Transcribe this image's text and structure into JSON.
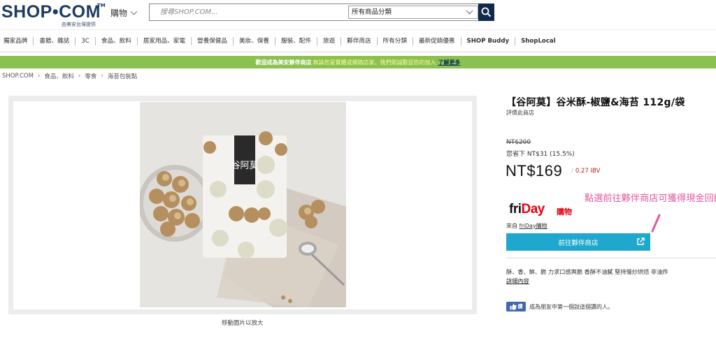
{
  "header": {
    "logo": "SHOP•COM",
    "logo_tm": "TM",
    "logo_sub": "由美安台灣提供",
    "shop_menu": "購物",
    "search_placeholder": "搜尋SHOP.COM...",
    "category_select": "所有商品分類"
  },
  "nav": {
    "items": [
      "獨家品牌",
      "書籍、雜誌",
      "3C",
      "食品、飲料",
      "居家用品、家電",
      "營養保健品",
      "美妝、保養",
      "服裝、配件",
      "旅遊",
      "夥伴商店",
      "所有分類",
      "最新促銷優惠",
      "SHOP Buddy",
      "ShopLocal"
    ]
  },
  "banner": {
    "part1": "歡迎成為美安夥伴商店",
    "part2": "無論您是實體或網路店家，我們鼎誠歡迎您的加入",
    "link": "了解更多"
  },
  "breadcrumb": [
    "SHOP.COM",
    "食品、飲料",
    "零食",
    "海苔包裝點"
  ],
  "gallery": {
    "caption": "移動圖片以放大",
    "package_text": "谷阿莫"
  },
  "product": {
    "title": "【谷阿莫】谷米酥-椒鹽&海苔 112g/袋",
    "rate_link": "評價此商店",
    "old_price": "NT$200",
    "save": "您省下 NT$31 (15.5%)",
    "price": "NT$169",
    "ibv": "0.27 IBV",
    "annotation": "點選前往夥伴商店可獲得現金回饋",
    "seller_logo_a": "fri",
    "seller_logo_b": "Day",
    "seller_logo_c": "購物",
    "from_label": "來自",
    "from_shop": "friDay購物",
    "cta": "前往夥伴商店",
    "description": "酥、香、鮮、脆 力求口感爽脆 香酥不油膩 堅持慢炒烘焙 非油炸",
    "more": "詳細內容"
  },
  "social": {
    "like_label": "讚",
    "like_text": "成為朋友中第一個說這個讚的人。"
  },
  "colors": {
    "brand_navy": "#1d3a66",
    "banner_green": "#8cc152",
    "cta_blue": "#1fa8cd",
    "annotation_pink": "#e7559a",
    "ibv_red": "#b22222",
    "facebook_blue": "#4267b2"
  }
}
